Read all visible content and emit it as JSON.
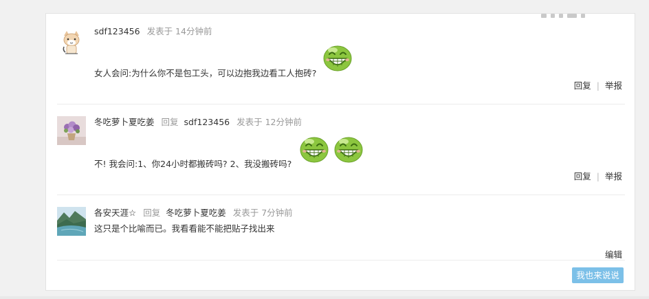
{
  "comments": [
    {
      "user": "sdf123456",
      "reply_label": "",
      "reply_to": "",
      "time": "发表于 14分钟前",
      "content": "女人会问:为什么你不是包工头，可以边抱我边看工人抱砖?",
      "emoji": [
        "grin-icon"
      ],
      "actions": {
        "reply": "回复",
        "sep": "|",
        "report": "举报"
      }
    },
    {
      "user": "冬吃萝卜夏吃姜",
      "reply_label": "回复",
      "reply_to": "sdf123456",
      "time": "发表于 12分钟前",
      "content": "不!  我会问:1、你24小时都搬砖吗? 2、我没搬砖吗?",
      "emoji": [
        "grin-icon",
        "grin-icon"
      ],
      "actions": {
        "reply": "回复",
        "sep": "|",
        "report": "举报"
      }
    },
    {
      "user": "各安天涯☆",
      "reply_label": "回复",
      "reply_to": "冬吃萝卜夏吃姜",
      "time": "发表于 7分钟前",
      "content": "这只是个比喻而已。我看看能不能把贴子找出来",
      "emoji": [],
      "actions": {
        "edit": "编辑"
      }
    }
  ],
  "speak_button": "我也来说说",
  "colors": {
    "accent_button": "#7cc0e8",
    "emoji_green": "#8cc63f",
    "muted_text": "#999999"
  }
}
